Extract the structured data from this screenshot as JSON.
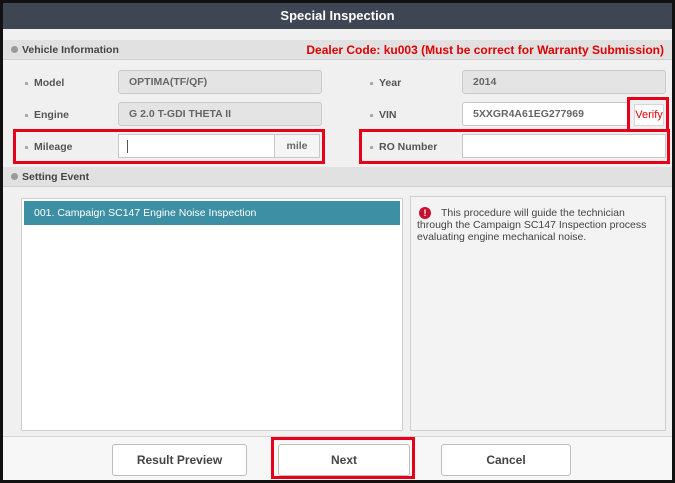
{
  "window": {
    "title": "Special Inspection"
  },
  "vehicle_info": {
    "header": "Vehicle Information",
    "dealer_code_text": "Dealer Code: ku003  (Must be correct for Warranty Submission)",
    "model": {
      "label": "Model",
      "value": "OPTIMA(TF/QF)"
    },
    "year": {
      "label": "Year",
      "value": "2014"
    },
    "engine": {
      "label": "Engine",
      "value": "G 2.0 T-GDI THETA II"
    },
    "vin": {
      "label": "VIN",
      "value": "5XXGR4A61EG277969",
      "verify_label": "Verify"
    },
    "mileage": {
      "label": "Mileage",
      "value": "",
      "unit": "mile"
    },
    "ro_number": {
      "label": "RO Number",
      "value": ""
    }
  },
  "setting_event": {
    "header": "Setting Event",
    "events": [
      "001. Campaign SC147 Engine Noise Inspection"
    ],
    "description": "This procedure will guide the technician through the Campaign SC147 Inspection process evaluating engine mechanical noise."
  },
  "footer": {
    "result_preview_label": "Result Preview",
    "next_label": "Next",
    "cancel_label": "Cancel"
  },
  "colors": {
    "title_bar": "#3e4553",
    "highlight_red": "#e8001a",
    "selected_event": "#3d8fa3",
    "dealer_text": "#e00000"
  }
}
